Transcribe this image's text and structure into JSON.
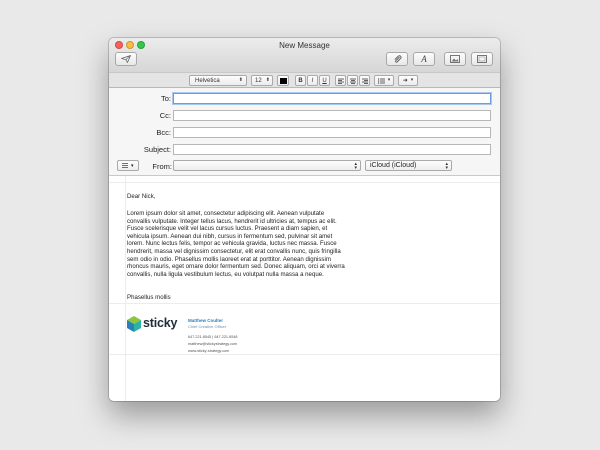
{
  "window": {
    "title": "New Message"
  },
  "toolbar": {
    "send_icon": "paper-plane-icon",
    "attach_icon": "paperclip-icon",
    "format_icon": "font-A-icon",
    "photo_icon": "photo-browser-icon",
    "template_icon": "stationery-icon"
  },
  "format_bar": {
    "font": "Helvetica",
    "size": "12",
    "bold": "B",
    "italic": "I",
    "underline": "U",
    "text_color": "#000000"
  },
  "headers": {
    "to_label": "To:",
    "to_value": "",
    "cc_label": "Cc:",
    "cc_value": "",
    "bcc_label": "Bcc:",
    "bcc_value": "",
    "subject_label": "Subject:",
    "subject_value": "",
    "from_label": "From:",
    "from_value": "",
    "account": "iCloud (iCloud)"
  },
  "message": {
    "greeting": "Dear Nick,",
    "body": "Lorem ipsum dolor sit amet, consectetur adipiscing elit. Aenean vulputate convallis vulputate. Integer tellus lacus, hendrerit id ultricies at, tempus ac elit. Fusce scelerisque velit vel lacus cursus luctus. Praesent a diam sapien, et vehicula ipsum. Aenean dui nibh, cursus in fermentum sed, pulvinar sit amet lorem. Nunc lectus felis, tempor ac vehicula gravida, luctus nec massa. Fusce hendrerit, massa vel dignissim consectetur, elit erat convallis nunc, quis fringilla sem odio in odio. Phasellus mollis laoreet erat at porttitor. Aenean dignissim rhoncus mauris, eget ornare dolor fermentum sed. Donec aliquam, orci at viverra convallis, nulla ligula vestibulum lectus, eu volutpat nulla massa a neque.",
    "closing": "Phasellus mollis"
  },
  "signature": {
    "logo_text": "sticky",
    "name": "Matthew Coulter",
    "role": "Chief Creative Officer",
    "phones": "647.221.8545  |  647.221.8548",
    "email": "matthew@stickystrategy.com",
    "website": "www.sticky-strategy.com",
    "colors": {
      "green": "#8cc63f",
      "blue": "#2a7fb8",
      "teal": "#2bb3a3"
    }
  }
}
